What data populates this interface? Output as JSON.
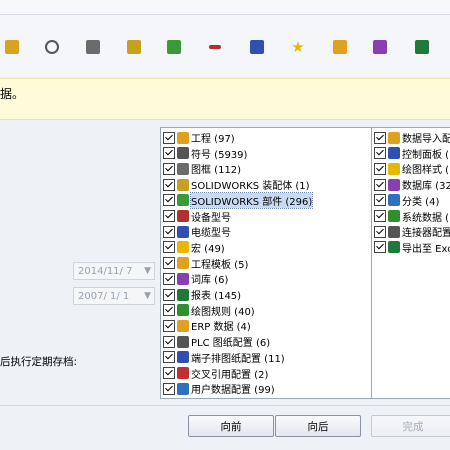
{
  "colors": {
    "accent": "#316ac5",
    "banner_bg": "#fdfbd9",
    "selected_bg": "#c9dbf3"
  },
  "toolbar": {
    "icons": [
      "assembly-icon",
      "symbol-icon",
      "frame-icon",
      "solid-part-icon",
      "solid-part-2-icon",
      "tools-icon",
      "cable-icon",
      "star-icon",
      "template-icon",
      "library-icon",
      "report-icon"
    ]
  },
  "banner": {
    "text": "据。"
  },
  "dates": {
    "from": "2014/11/ 7",
    "to": "2007/ 1/ 1"
  },
  "schedule_label": "后执行定期存档:",
  "left_items": [
    {
      "label": "工程 (97)",
      "icon": "project-icon",
      "color": "#e0a020"
    },
    {
      "label": "符号 (5939)",
      "icon": "symbol-icon",
      "color": "#555555"
    },
    {
      "label": "图框 (112)",
      "icon": "frame-icon",
      "color": "#6b6b6b"
    },
    {
      "label": "SOLIDWORKS 装配体 (1)",
      "icon": "assembly-icon",
      "color": "#c8a020"
    },
    {
      "label": "SOLIDWORKS 部件 (296)",
      "icon": "part-icon",
      "color": "#3a9a3a",
      "selected": true
    },
    {
      "label": "设备型号",
      "icon": "tools-icon",
      "color": "#b03030"
    },
    {
      "label": "电缆型号",
      "icon": "cable-icon",
      "color": "#3050b0"
    },
    {
      "label": "宏 (49)",
      "icon": "macro-icon",
      "color": "#e6b800"
    },
    {
      "label": "工程模板 (5)",
      "icon": "template-icon",
      "color": "#e0a020"
    },
    {
      "label": "词库 (6)",
      "icon": "dictionary-icon",
      "color": "#8a3fb0"
    },
    {
      "label": "报表 (145)",
      "icon": "report-icon",
      "color": "#1f7a3a"
    },
    {
      "label": "绘图规则 (40)",
      "icon": "rules-icon",
      "color": "#2f8f2f"
    },
    {
      "label": "ERP 数据 (4)",
      "icon": "erp-icon",
      "color": "#e0a020"
    },
    {
      "label": "PLC 图纸配置 (6)",
      "icon": "plc-icon",
      "color": "#555555"
    },
    {
      "label": "端子排图纸配置 (11)",
      "icon": "terminal-icon",
      "color": "#3050b0"
    },
    {
      "label": "交叉引用配置 (2)",
      "icon": "cross-ref-icon",
      "color": "#c03030"
    },
    {
      "label": "用户数据配置 (99)",
      "icon": "user-data-icon",
      "color": "#3070c0"
    }
  ],
  "right_items": [
    {
      "label": "数据导入配",
      "icon": "import-icon",
      "color": "#e0a020"
    },
    {
      "label": "控制面板 (",
      "icon": "panel-icon",
      "color": "#3050b0"
    },
    {
      "label": "绘图样式 (",
      "icon": "style-icon",
      "color": "#e6b800"
    },
    {
      "label": "数据库 (32",
      "icon": "database-icon",
      "color": "#8a3fb0"
    },
    {
      "label": "分类 (4)",
      "icon": "category-icon",
      "color": "#3070c0"
    },
    {
      "label": "系统数据 (",
      "icon": "system-data-icon",
      "color": "#2f8f2f"
    },
    {
      "label": "连接器配置",
      "icon": "connector-icon",
      "color": "#555555"
    },
    {
      "label": "导出至 Exc",
      "icon": "excel-icon",
      "color": "#1f7a3a"
    }
  ],
  "buttons": {
    "back": "向前",
    "next": "向后",
    "finish": "完成"
  }
}
